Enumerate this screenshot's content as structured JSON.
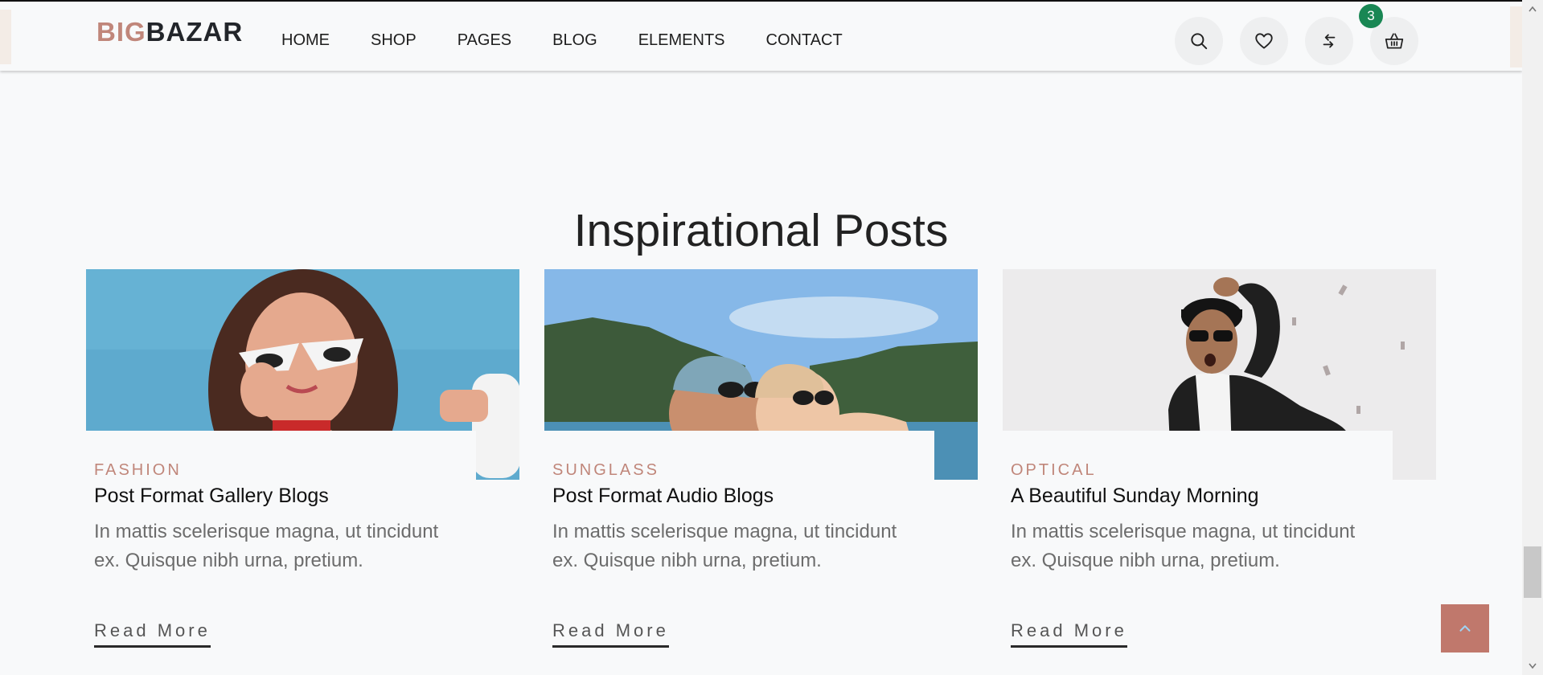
{
  "header": {
    "logo_part1": "BIG",
    "logo_part2": "BAZAR",
    "nav": [
      "HOME",
      "SHOP",
      "PAGES",
      "BLOG",
      "ELEMENTS",
      "CONTACT"
    ],
    "cart_count": "3",
    "icons": [
      "search-icon",
      "heart-icon",
      "compare-icon",
      "basket-icon"
    ]
  },
  "section": {
    "title": "Inspirational Posts"
  },
  "posts": [
    {
      "category": "FASHION",
      "title": "Post Format Gallery Blogs",
      "excerpt": "In mattis scelerisque magna, ut tincidunt ex. Quisque nibh urna, pretium.",
      "read_more": "Read More"
    },
    {
      "category": "SUNGLASS",
      "title": "Post Format Audio Blogs",
      "excerpt": "In mattis scelerisque magna, ut tincidunt ex. Quisque nibh urna, pretium.",
      "read_more": "Read More"
    },
    {
      "category": "OPTICAL",
      "title": "A Beautiful Sunday Morning",
      "excerpt": "In mattis scelerisque magna, ut tincidunt ex. Quisque nibh urna, pretium.",
      "read_more": "Read More"
    }
  ],
  "colors": {
    "accent": "#c0867a",
    "badge": "#198754",
    "scroll_top": "#c0786c",
    "text_muted": "#6c6c6c"
  }
}
